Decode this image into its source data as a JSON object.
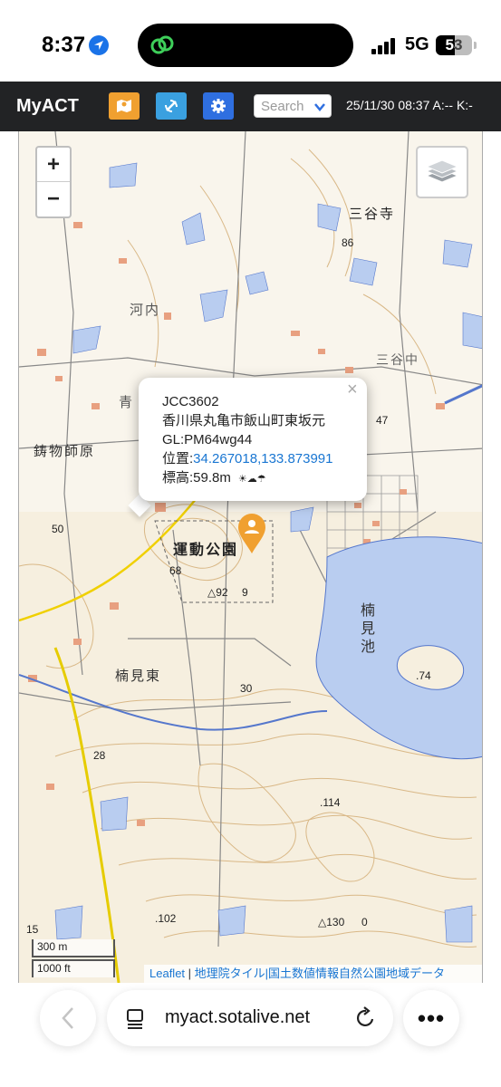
{
  "status_bar": {
    "time": "8:37",
    "network": "5G",
    "battery_level": "53",
    "battery_fraction": 0.53
  },
  "header": {
    "title": "MyACT",
    "search_placeholder": "Search",
    "status_text": "25/11/30 08:37 A:-- K:-"
  },
  "map": {
    "labels": {
      "sanyaji": "三谷寺",
      "kounai": "河内",
      "imoji": "鋳物師原",
      "kusumi_higashi": "楠見東",
      "undo_koen": "運動公園",
      "kusumi_ike": "楠見池",
      "sanyanaka": "三谷中",
      "e86": "86",
      "e47": "47",
      "e50": "50",
      "e68": "68",
      "e92": "△92",
      "e9": "9",
      "e30": "30",
      "e28": "28",
      "e74": ".74",
      "e114": ".114",
      "e102": ".102",
      "e130": "△130",
      "e0": "0",
      "ao": "青"
    },
    "popup": {
      "callsign_ref": "JCC3602",
      "address": "香川県丸亀市飯山町東坂元",
      "grid_line": "GL:PM64wg44",
      "position_label": "位置:",
      "position_value": "34.267018,133.873991",
      "elevation": "標高:59.8m",
      "weather": "☀☁☂",
      "close": "×"
    },
    "zoom_in": "+",
    "zoom_out": "−",
    "scale": {
      "zoom_level": "15",
      "metric": "300 m",
      "imperial": "1000 ft"
    },
    "attribution": {
      "leaflet": "Leaflet",
      "separator": " | ",
      "sources": "地理院タイル|国土数値情報自然公園地域データ"
    }
  },
  "browser": {
    "url": "myact.sotalive.net",
    "more": "•••"
  },
  "colors": {
    "header_bg": "#222325",
    "map_btn": "#f0a030",
    "sync_btn": "#3aa0e0",
    "gear_btn": "#2f6fe0",
    "water": "#b9cdf0",
    "link": "#1976d2",
    "marker": "#f0a030"
  }
}
